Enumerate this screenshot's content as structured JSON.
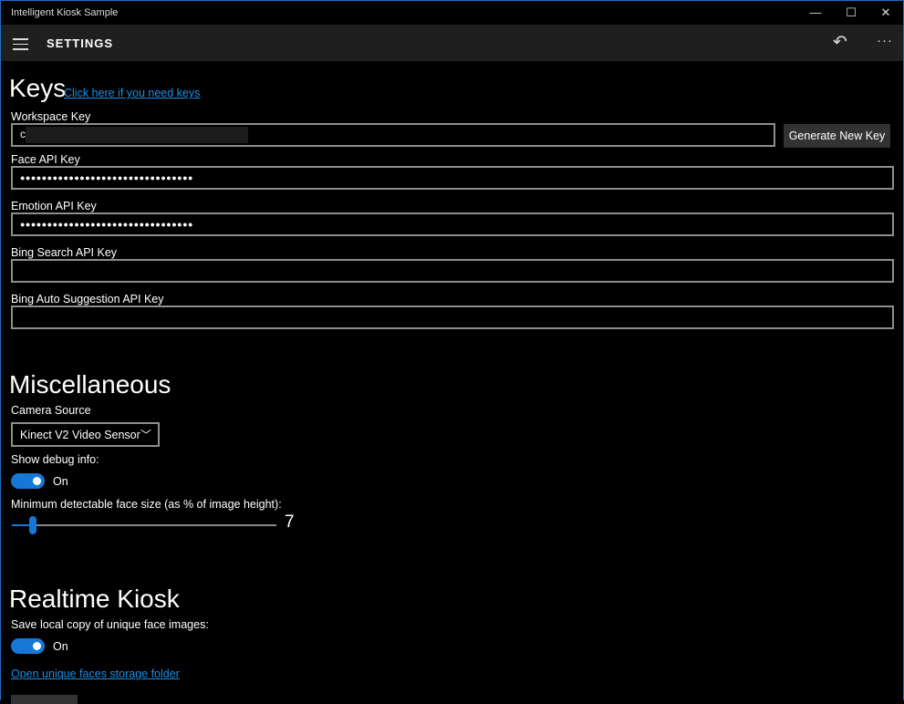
{
  "window": {
    "title": "Intelligent Kiosk Sample",
    "minimize": "—",
    "maximize": "☐",
    "close": "✕"
  },
  "appbar": {
    "title": "SETTINGS",
    "menu_icon": "hamburger-icon",
    "undo_icon": "undo-icon",
    "more": "···"
  },
  "keys": {
    "heading": "Keys",
    "link": "Click here if you need keys",
    "workspace_label": "Workspace Key",
    "workspace_value": "c",
    "generate_button": "Generate New Key",
    "face_label": "Face API Key",
    "face_value": "●●●●●●●●●●●●●●●●●●●●●●●●●●●●●●●●",
    "emotion_label": "Emotion API Key",
    "emotion_value": "●●●●●●●●●●●●●●●●●●●●●●●●●●●●●●●●",
    "bing_label": "Bing Search API Key",
    "bing_value": "",
    "bing_auto_label": "Bing Auto Suggestion API Key",
    "bing_auto_value": ""
  },
  "misc": {
    "heading": "Miscellaneous",
    "camera_label": "Camera Source",
    "camera_value": "Kinect V2 Video Sensor",
    "debug_label": "Show debug info:",
    "debug_state": "On",
    "face_size_label": "Minimum detectable face size (as % of image height):",
    "face_size_value": "7",
    "face_size_fraction": 0.08
  },
  "kiosk": {
    "heading": "Realtime Kiosk",
    "save_label": "Save local copy of unique face images:",
    "save_state": "On",
    "folder_link": "Open unique faces storage folder"
  }
}
